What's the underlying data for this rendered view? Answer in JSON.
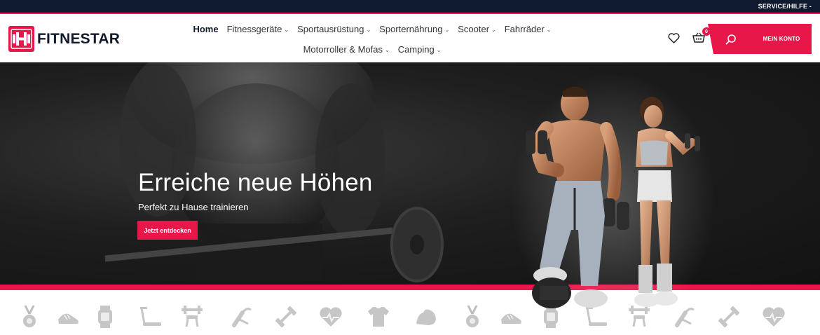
{
  "topbar": {
    "service_label": "SERVICE/HILFE -"
  },
  "brand": {
    "name": "FITNESTAR",
    "accent": "#e8174a",
    "dark": "#111a2b"
  },
  "nav": {
    "items": [
      {
        "label": "Home",
        "active": true,
        "dropdown": false
      },
      {
        "label": "Fitnessgeräte",
        "dropdown": true
      },
      {
        "label": "Sportausrüstung",
        "dropdown": true
      },
      {
        "label": "Sporternährung",
        "dropdown": true
      },
      {
        "label": "Scooter",
        "dropdown": true
      },
      {
        "label": "Fahrräder",
        "dropdown": true
      },
      {
        "label": "Motorroller & Mofas",
        "dropdown": true
      },
      {
        "label": "Camping",
        "dropdown": true
      }
    ],
    "chevron": "⌄"
  },
  "header": {
    "wishlist_icon": "heart-icon",
    "cart_icon": "basket-icon",
    "cart_count": "0",
    "search_icon": "search-icon",
    "account_label": "MEIN KONTO"
  },
  "hero": {
    "title": "Erreiche neue Höhen",
    "subtitle": "Perfekt zu Hause trainieren",
    "cta_label": "Jetzt entdecken"
  },
  "icon_strip": [
    "medal-icon",
    "sneaker-icon",
    "smartwatch-icon",
    "treadmill-icon",
    "weight-bench-icon",
    "hand-grip-icon",
    "dumbbell-icon",
    "heartbeat-icon",
    "jersey-icon",
    "flexed-arm-icon",
    "medal-icon",
    "sneaker-icon",
    "smartwatch-icon",
    "treadmill-icon",
    "weight-bench-icon",
    "hand-grip-icon",
    "dumbbell-icon",
    "heartbeat-icon"
  ]
}
